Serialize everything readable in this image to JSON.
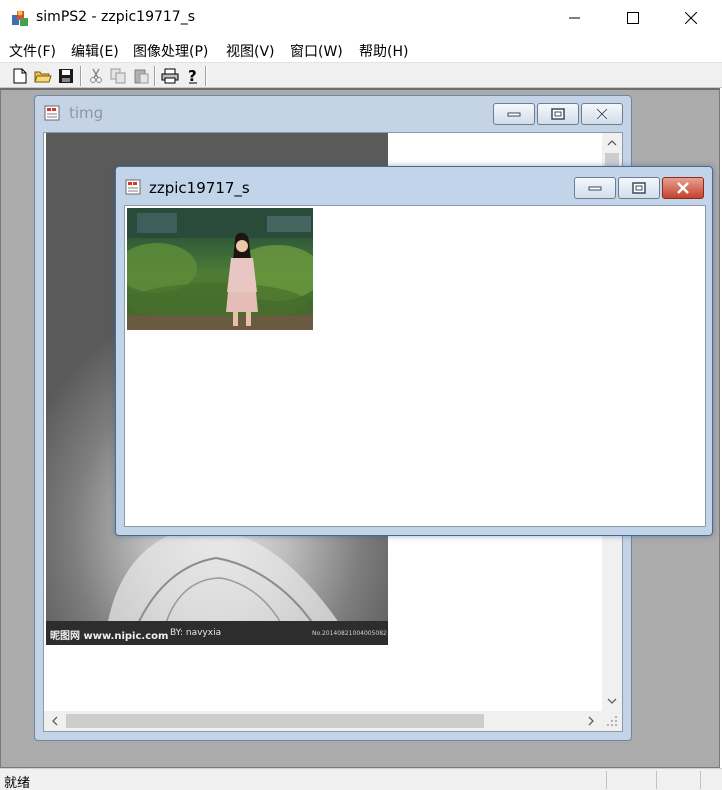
{
  "app": {
    "title": "simPS2 - zzpic19717_s"
  },
  "menu": {
    "items": [
      "文件(F)",
      "编辑(E)",
      "图像处理(P)",
      "视图(V)",
      "窗口(W)",
      "帮助(H)"
    ]
  },
  "toolbar": {
    "buttons": [
      "new-file-icon",
      "open-folder-icon",
      "save-icon",
      "cut-icon",
      "copy-icon",
      "paste-icon",
      "print-icon",
      "help-icon"
    ]
  },
  "windows": {
    "back": {
      "title": "timg"
    },
    "front": {
      "title": "zzpic19717_s"
    }
  },
  "image": {
    "watermark_left": "昵图网 www.nipic.com",
    "watermark_by": "BY: navyxia",
    "watermark_right": "No.20140821004005082"
  },
  "status": {
    "text": "就绪"
  },
  "colors": {
    "close_red": "#c4422f",
    "mdi_background": "#ababab",
    "child_frame": "#c4d3e5"
  }
}
